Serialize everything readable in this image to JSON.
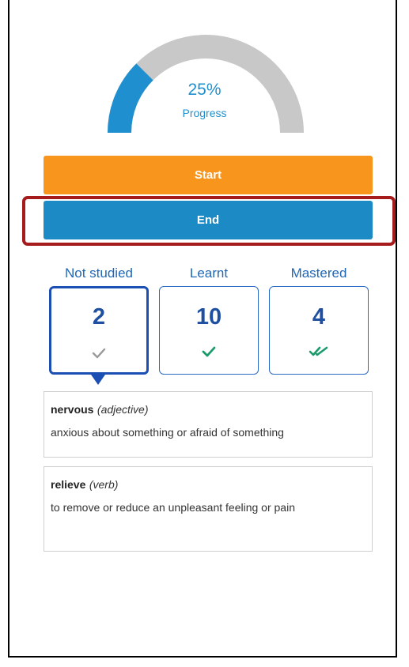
{
  "progress": {
    "percent_text": "25%",
    "label": "Progress",
    "fraction": 0.25,
    "fill_color": "#1f8fcf",
    "track_color": "#c8c8c8"
  },
  "buttons": {
    "start_label": "Start",
    "end_label": "End"
  },
  "categories": [
    {
      "label": "Not studied",
      "count": "2",
      "icon": "grey-check-icon",
      "selected": true
    },
    {
      "label": "Learnt",
      "count": "10",
      "icon": "green-check-icon",
      "selected": false
    },
    {
      "label": "Mastered",
      "count": "4",
      "icon": "double-check-icon",
      "selected": false
    }
  ],
  "words": [
    {
      "word": "nervous",
      "pos": "(adjective)",
      "definition": "anxious about something or afraid of something"
    },
    {
      "word": "relieve",
      "pos": "(verb)",
      "definition": "to remove or reduce an unpleasant feeling or pain"
    }
  ],
  "colors": {
    "accent_blue": "#1c8ac4",
    "start_orange": "#f7951d",
    "highlight_red": "#a61b1b",
    "check_green": "#1a9b6c",
    "check_grey": "#9a9a9a"
  }
}
